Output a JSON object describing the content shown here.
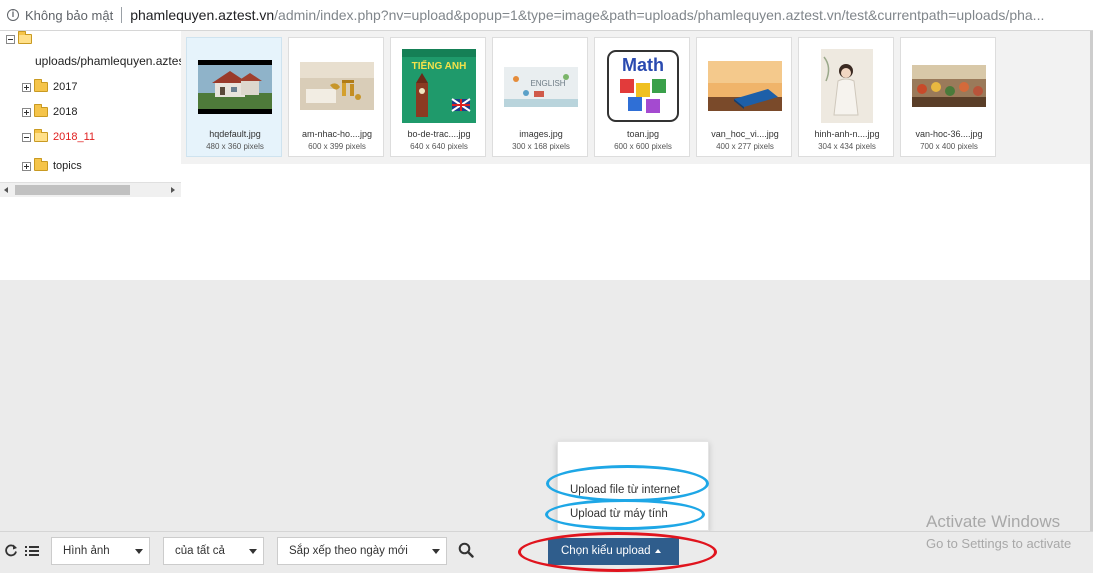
{
  "address_bar": {
    "security_label": "Không bảo mật",
    "host": "phamlequyen.aztest.vn",
    "path": "/admin/index.php?nv=upload&popup=1&type=image&path=uploads/phamlequyen.aztest.vn/test&currentpath=uploads/pha..."
  },
  "tree": {
    "root": "uploads/phamlequyen.aztes",
    "items": [
      {
        "label": "2017",
        "selected": false
      },
      {
        "label": "2018",
        "selected": false
      },
      {
        "label": "2018_11",
        "selected": true
      },
      {
        "label": "topics",
        "selected": false
      }
    ]
  },
  "files": [
    {
      "name": "hqdefault.jpg",
      "size": "480 x 360 pixels"
    },
    {
      "name": "am-nhac-ho....jpg",
      "size": "600 x 399 pixels"
    },
    {
      "name": "bo-de-trac....jpg",
      "size": "640 x 640 pixels"
    },
    {
      "name": "images.jpg",
      "size": "300 x 168 pixels"
    },
    {
      "name": "toan.jpg",
      "size": "600 x 600 pixels"
    },
    {
      "name": "van_hoc_vi....jpg",
      "size": "400 x 277 pixels"
    },
    {
      "name": "hinh-anh-n....jpg",
      "size": "304 x 434 pixels"
    },
    {
      "name": "van-hoc-36....jpg",
      "size": "700 x 400 pixels"
    }
  ],
  "thumb_text": {
    "tieng_anh": "TIẾNG ANH",
    "math": "Math",
    "english": "ENGLISH"
  },
  "upload_menu": {
    "from_internet": "Upload file từ internet",
    "from_computer": "Upload từ máy tính"
  },
  "toolbar": {
    "type_filter": "Hình ảnh",
    "owner_filter": "của tất cả",
    "sort": "Sắp xếp theo ngày mới",
    "upload_button": "Chọn kiểu upload"
  },
  "watermark": {
    "line1": "Activate Windows",
    "line2": "Go to Settings to activate"
  },
  "colors": {
    "selected_folder": "#e02020",
    "upload_button": "#2f5d8c",
    "highlight_blue": "#1ea7e6",
    "highlight_red": "#e0141e"
  }
}
